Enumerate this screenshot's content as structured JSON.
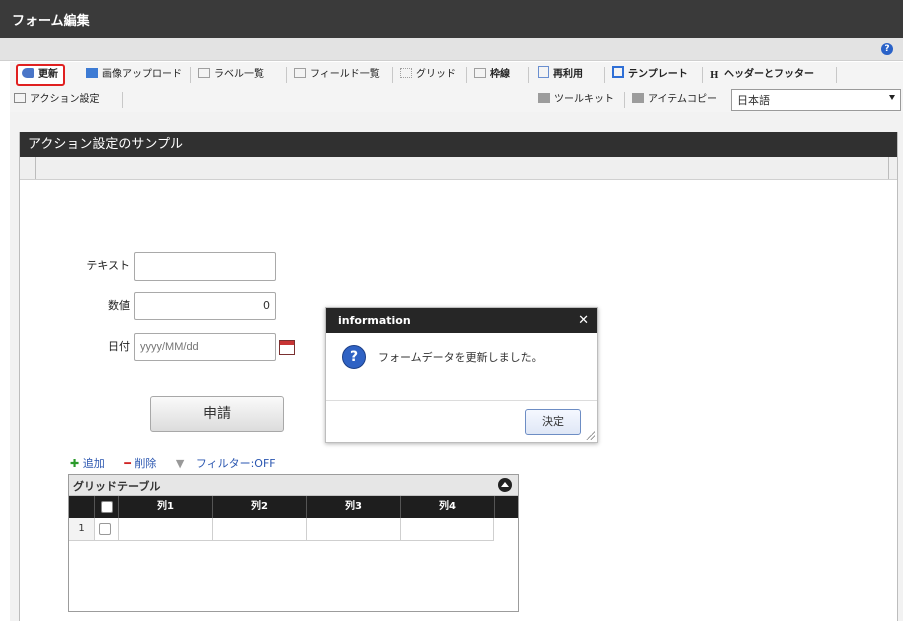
{
  "window": {
    "title": "フォーム編集"
  },
  "help": {
    "icon": "help-icon",
    "glyph": "?"
  },
  "toolbar": {
    "row1": [
      {
        "label": "更新",
        "icon": "update-icon",
        "color": "#4a76c8"
      },
      {
        "label": "画像アップロード",
        "icon": "image-upload-icon",
        "color": "#3d7bd4"
      },
      {
        "label": "ラベル一覧",
        "icon": "label-list-icon",
        "color": "#a0a0a0"
      },
      {
        "label": "フィールド一覧",
        "icon": "field-list-icon",
        "color": "#a0a0a0"
      },
      {
        "label": "グリッド",
        "icon": "grid-icon",
        "color": "#b0b0b0"
      },
      {
        "label": "枠線",
        "icon": "border-icon",
        "color": "#b0b0b0"
      },
      {
        "label": "再利用",
        "icon": "reuse-icon",
        "color": "#6a8fd0"
      },
      {
        "label": "テンプレート",
        "icon": "template-icon",
        "color": "#2f6fd6"
      },
      {
        "label": "ヘッダーとフッター",
        "icon": "header-footer-icon",
        "color": "#222222"
      }
    ],
    "row2_left": {
      "label": "アクション設定",
      "icon": "action-settings-icon"
    },
    "row2_right": [
      {
        "label": "ツールキット",
        "icon": "toolkit-icon"
      },
      {
        "label": "アイテムコピー",
        "icon": "item-copy-icon"
      }
    ],
    "language": "日本語"
  },
  "form": {
    "title": "アクション設定のサンプル",
    "fields": {
      "text_label": "テキスト",
      "text_value": "",
      "number_label": "数値",
      "number_value": "0",
      "date_label": "日付",
      "date_placeholder": "yyyy/MM/dd"
    },
    "apply_button": "申請"
  },
  "grid": {
    "actions": {
      "add": "追加",
      "delete": "削除",
      "filter": "フィルター:OFF"
    },
    "title": "グリッドテーブル",
    "columns": [
      "列1",
      "列2",
      "列3",
      "列4"
    ],
    "rows": [
      {
        "num": "1",
        "cells": [
          "",
          "",
          "",
          ""
        ]
      }
    ]
  },
  "dialog": {
    "title": "information",
    "message": "フォームデータを更新しました。",
    "ok_button": "決定"
  },
  "colors": {
    "highlight": "#e02020",
    "header": "#303030",
    "link": "#2a56b0"
  }
}
